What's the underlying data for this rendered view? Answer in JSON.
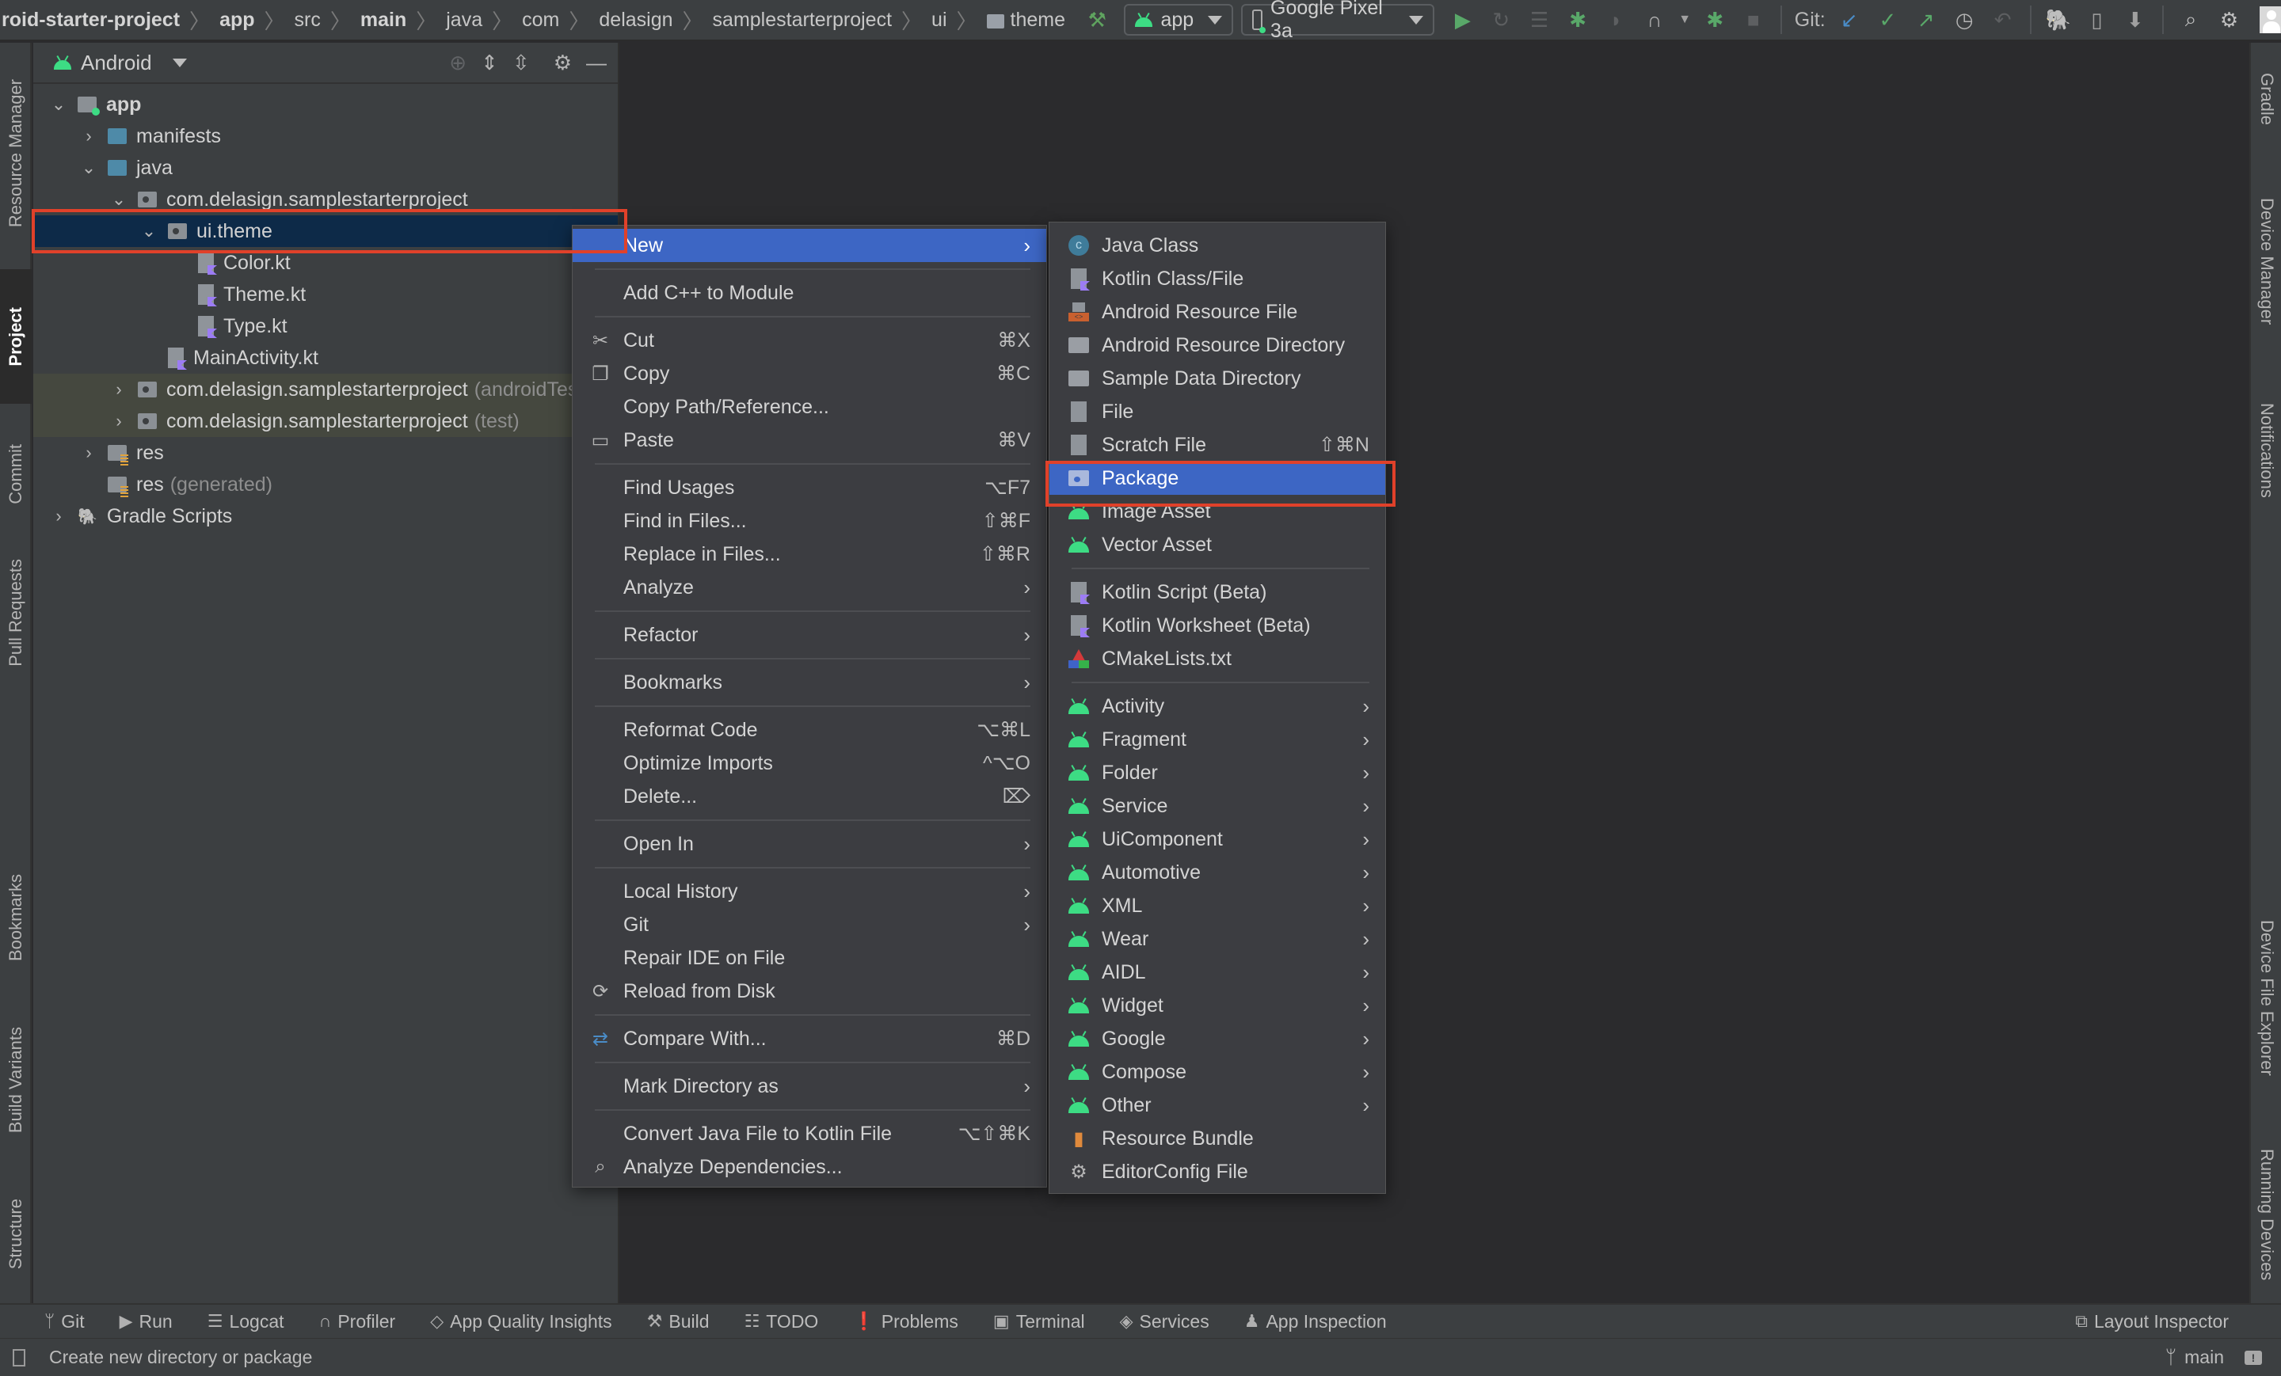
{
  "breadcrumb": [
    "roid-starter-project",
    "app",
    "src",
    "main",
    "java",
    "com",
    "delasign",
    "samplestarterproject",
    "ui",
    "theme"
  ],
  "toolbar": {
    "run_config": "app",
    "device": "Google Pixel 3a",
    "git_label": "Git:",
    "icons": [
      "hammer-icon",
      "run-icon",
      "apply-changes-icon",
      "apply-code-changes-icon",
      "debug-icon",
      "profile-icon",
      "attach-debugger-icon",
      "stop-icon",
      "git-update-icon",
      "git-commit-icon",
      "git-push-icon",
      "git-history-icon",
      "git-rollback-icon",
      "gradle-sync-icon",
      "avd-manager-icon",
      "sdk-manager-icon",
      "search-icon",
      "settings-icon",
      "avatar"
    ]
  },
  "left_strip": [
    "Resource Manager",
    "Project",
    "Commit",
    "Pull Requests",
    "Bookmarks",
    "Build Variants",
    "Structure"
  ],
  "right_strip": [
    "Gradle",
    "Device Manager",
    "Notifications",
    "Device File Explorer",
    "Running Devices"
  ],
  "project_panel": {
    "view": "Android",
    "tree": [
      {
        "label": "app",
        "depth": 0,
        "expanded": true,
        "icon": "module",
        "bold": true
      },
      {
        "label": "manifests",
        "depth": 1,
        "expanded": false,
        "icon": "folder-blue"
      },
      {
        "label": "java",
        "depth": 1,
        "expanded": true,
        "icon": "folder-blue"
      },
      {
        "label": "com.delasign.samplestarterproject",
        "depth": 2,
        "expanded": true,
        "icon": "package"
      },
      {
        "label": "ui.theme",
        "depth": 3,
        "expanded": true,
        "icon": "package",
        "selected": true
      },
      {
        "label": "Color.kt",
        "depth": 4,
        "icon": "kotlin-file"
      },
      {
        "label": "Theme.kt",
        "depth": 4,
        "icon": "kotlin-file"
      },
      {
        "label": "Type.kt",
        "depth": 4,
        "icon": "kotlin-file"
      },
      {
        "label": "MainActivity.kt",
        "depth": 3,
        "icon": "kotlin-file"
      },
      {
        "label": "com.delasign.samplestarterproject",
        "suffix": "(androidTest)",
        "depth": 2,
        "expanded": false,
        "icon": "package",
        "test": true
      },
      {
        "label": "com.delasign.samplestarterproject",
        "suffix": "(test)",
        "depth": 2,
        "expanded": false,
        "icon": "package",
        "test": true
      },
      {
        "label": "res",
        "depth": 1,
        "expanded": false,
        "icon": "res-folder"
      },
      {
        "label": "res",
        "suffix": "(generated)",
        "depth": 1,
        "icon": "res-folder"
      },
      {
        "label": "Gradle Scripts",
        "depth": 0,
        "expanded": false,
        "icon": "gradle"
      }
    ]
  },
  "context_menu": {
    "items": [
      {
        "label": "New",
        "submenu": true,
        "highlighted": true
      },
      {
        "sep": true
      },
      {
        "label": "Add C++ to Module"
      },
      {
        "sep": true
      },
      {
        "label": "Cut",
        "shortcut": "⌘X",
        "icon": "scissors-icon"
      },
      {
        "label": "Copy",
        "shortcut": "⌘C",
        "icon": "copy-icon"
      },
      {
        "label": "Copy Path/Reference..."
      },
      {
        "label": "Paste",
        "shortcut": "⌘V",
        "icon": "clipboard-icon"
      },
      {
        "sep": true
      },
      {
        "label": "Find Usages",
        "shortcut": "⌥F7"
      },
      {
        "label": "Find in Files...",
        "shortcut": "⇧⌘F"
      },
      {
        "label": "Replace in Files...",
        "shortcut": "⇧⌘R"
      },
      {
        "label": "Analyze",
        "submenu": true
      },
      {
        "sep": true
      },
      {
        "label": "Refactor",
        "submenu": true
      },
      {
        "sep": true
      },
      {
        "label": "Bookmarks",
        "submenu": true
      },
      {
        "sep": true
      },
      {
        "label": "Reformat Code",
        "shortcut": "⌥⌘L"
      },
      {
        "label": "Optimize Imports",
        "shortcut": "^⌥O"
      },
      {
        "label": "Delete...",
        "shortcut": "⌦"
      },
      {
        "sep": true
      },
      {
        "label": "Open In",
        "submenu": true
      },
      {
        "sep": true
      },
      {
        "label": "Local History",
        "submenu": true
      },
      {
        "label": "Git",
        "submenu": true
      },
      {
        "label": "Repair IDE on File"
      },
      {
        "label": "Reload from Disk",
        "icon": "reload-icon"
      },
      {
        "sep": true
      },
      {
        "label": "Compare With...",
        "shortcut": "⌘D",
        "icon": "compare-icon"
      },
      {
        "sep": true
      },
      {
        "label": "Mark Directory as",
        "submenu": true
      },
      {
        "sep": true
      },
      {
        "label": "Convert Java File to Kotlin File",
        "shortcut": "⌥⇧⌘K"
      },
      {
        "label": "Analyze Dependencies...",
        "icon": "analyze-dependencies-icon"
      }
    ]
  },
  "new_submenu": {
    "items": [
      {
        "label": "Java Class",
        "icon": "java-class-icon"
      },
      {
        "label": "Kotlin Class/File",
        "icon": "kotlin-file-icon"
      },
      {
        "label": "Android Resource File",
        "icon": "android-resource-file-icon"
      },
      {
        "label": "Android Resource Directory",
        "icon": "folder-icon"
      },
      {
        "label": "Sample Data Directory",
        "icon": "folder-icon"
      },
      {
        "label": "File",
        "icon": "file-icon"
      },
      {
        "label": "Scratch File",
        "shortcut": "⇧⌘N",
        "icon": "scratch-file-icon"
      },
      {
        "label": "Package",
        "icon": "package-icon",
        "highlighted": true
      },
      {
        "label": "Image Asset",
        "icon": "android-icon"
      },
      {
        "label": "Vector Asset",
        "icon": "android-icon"
      },
      {
        "sep": true
      },
      {
        "label": "Kotlin Script (Beta)",
        "icon": "kotlin-script-icon"
      },
      {
        "label": "Kotlin Worksheet (Beta)",
        "icon": "kotlin-script-icon"
      },
      {
        "label": "CMakeLists.txt",
        "icon": "cmake-icon"
      },
      {
        "sep": true
      },
      {
        "label": "Activity",
        "submenu": true,
        "icon": "android-icon"
      },
      {
        "label": "Fragment",
        "submenu": true,
        "icon": "android-icon"
      },
      {
        "label": "Folder",
        "submenu": true,
        "icon": "android-icon"
      },
      {
        "label": "Service",
        "submenu": true,
        "icon": "android-icon"
      },
      {
        "label": "UiComponent",
        "submenu": true,
        "icon": "android-icon"
      },
      {
        "label": "Automotive",
        "submenu": true,
        "icon": "android-icon"
      },
      {
        "label": "XML",
        "submenu": true,
        "icon": "android-icon"
      },
      {
        "label": "Wear",
        "submenu": true,
        "icon": "android-icon"
      },
      {
        "label": "AIDL",
        "submenu": true,
        "icon": "android-icon"
      },
      {
        "label": "Widget",
        "submenu": true,
        "icon": "android-icon"
      },
      {
        "label": "Google",
        "submenu": true,
        "icon": "android-icon"
      },
      {
        "label": "Compose",
        "submenu": true,
        "icon": "android-icon"
      },
      {
        "label": "Other",
        "submenu": true,
        "icon": "android-icon"
      },
      {
        "label": "Resource Bundle",
        "icon": "resource-bundle-icon"
      },
      {
        "label": "EditorConfig File",
        "icon": "gear-icon"
      }
    ]
  },
  "bottom_tools": [
    {
      "label": "Git",
      "icon": "git-branch-icon"
    },
    {
      "label": "Run",
      "icon": "run-icon"
    },
    {
      "label": "Logcat",
      "icon": "logcat-icon"
    },
    {
      "label": "Profiler",
      "icon": "profiler-icon"
    },
    {
      "label": "App Quality Insights",
      "icon": "app-quality-icon"
    },
    {
      "label": "Build",
      "icon": "hammer-icon"
    },
    {
      "label": "TODO",
      "icon": "list-icon"
    },
    {
      "label": "Problems",
      "icon": "problems-icon"
    },
    {
      "label": "Terminal",
      "icon": "terminal-icon"
    },
    {
      "label": "Services",
      "icon": "services-icon"
    },
    {
      "label": "App Inspection",
      "icon": "app-inspection-icon"
    }
  ],
  "layout_inspector": "Layout Inspector",
  "status": {
    "message": "Create new directory or package",
    "branch": "main"
  }
}
